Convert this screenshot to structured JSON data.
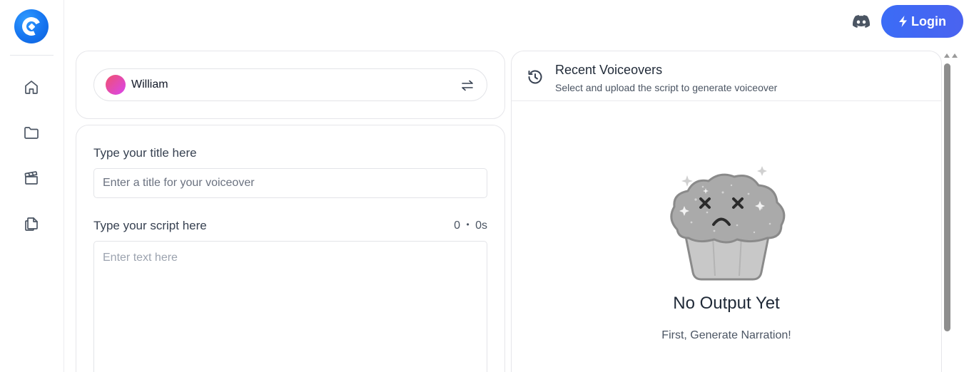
{
  "app": {
    "login_label": "Login"
  },
  "voice": {
    "name": "William"
  },
  "form": {
    "title_label": "Type your title here",
    "title_placeholder": "Enter a title for your voiceover",
    "script_label": "Type your script here",
    "char_count": "0",
    "separator": "•",
    "duration": "0s",
    "script_placeholder": "Enter text here"
  },
  "recent": {
    "title": "Recent Voiceovers",
    "subtitle": "Select and upload the script to generate voiceover",
    "empty_title": "No Output Yet",
    "empty_subtitle": "First, Generate Narration!"
  },
  "icons": {
    "sidebar": [
      "home-icon",
      "folder-icon",
      "clapperboard-icon",
      "documents-icon"
    ]
  },
  "colors": {
    "accent": "#3b6cf6",
    "logo": "#1574f0"
  }
}
